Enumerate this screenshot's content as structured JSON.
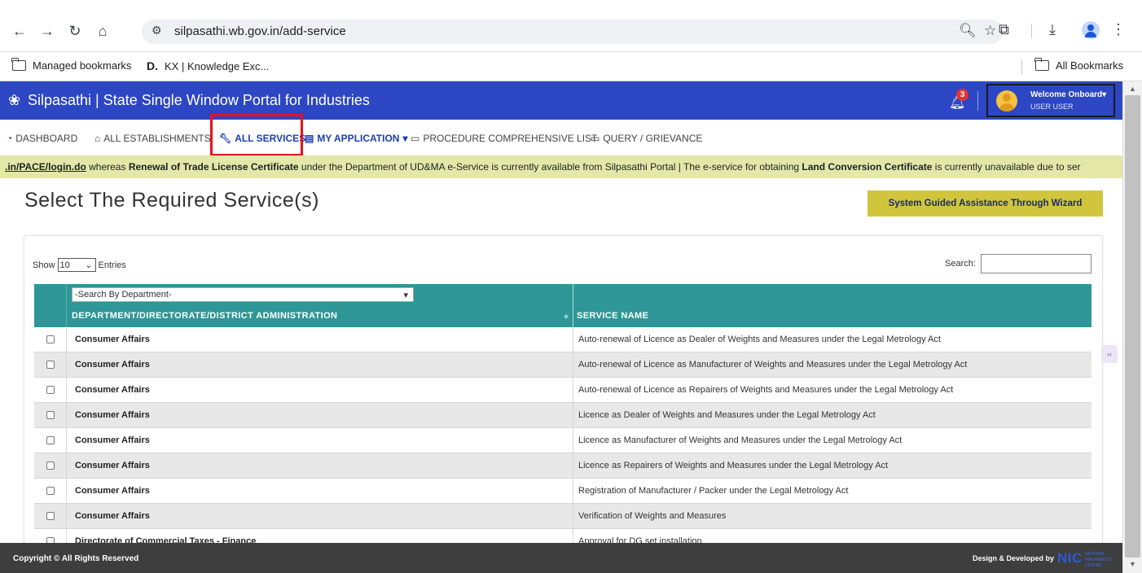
{
  "browser": {
    "url": "silpasathi.wb.gov.in/add-service",
    "bookmarks": [
      {
        "label": "Managed bookmarks"
      },
      {
        "prefix": "D.",
        "label": "KX | Knowledge Exc..."
      }
    ],
    "all_bookmarks_label": "All Bookmarks",
    "icons": {
      "back": "←",
      "forward": "→",
      "reload": "↻",
      "home": "⌂",
      "site_info": "⚙",
      "zoom": "🔍︎",
      "star": "☆",
      "extensions": "⧉",
      "download": "⤓",
      "menu": "⋮"
    }
  },
  "header": {
    "logo_icon": "❀",
    "title": "Silpasathi | State Single Window Portal for Industries",
    "notification_count": "3",
    "bell_icon": "🔔︎",
    "welcome": "Welcome Onboard",
    "user": "USER USER"
  },
  "nav": {
    "items": [
      {
        "icon": "◔",
        "label": "DASHBOARD"
      },
      {
        "icon": "⌂",
        "label": "ALL ESTABLISHMENTS"
      },
      {
        "icon": "🔧︎",
        "label": "ALL SERVICES"
      },
      {
        "icon": "▤",
        "label": "MY APPLICATION",
        "caret": "▾"
      },
      {
        "icon": "▭",
        "label": "PROCEDURE COMPREHENSIVE LIST"
      },
      {
        "icon": "▭",
        "label": "QUERY / GRIEVANCE"
      }
    ]
  },
  "ticker": {
    "link": ".in/PACE/login.do",
    "t1": " whereas ",
    "b1": "Renewal of Trade License Certificate",
    "t2": " under the Department of UD&MA e-Service is currently available from Silpasathi Portal | The e-service for obtaining ",
    "b2": "Land Conversion Certificate",
    "t3": " is currently unavailable due to ser"
  },
  "main": {
    "page_title": "Select The Required Service(s)",
    "wizard_button": "System Guided Assistance Through Wizard",
    "show_label": "Show",
    "entries_value": "10",
    "entries_label": "Entries",
    "search_label": "Search:",
    "search_value": ""
  },
  "table": {
    "dept_filter_placeholder": "-Search By Department-",
    "columns": [
      "DEPARTMENT/DIRECTORATE/DISTRICT ADMINISTRATION",
      "SERVICE NAME"
    ],
    "rows": [
      {
        "dept": "Consumer Affairs",
        "service": "Auto-renewal of Licence as Dealer of Weights and Measures under the Legal Metrology Act"
      },
      {
        "dept": "Consumer Affairs",
        "service": "Auto-renewal of Licence as Manufacturer of Weights and Measures under the Legal Metrology Act"
      },
      {
        "dept": "Consumer Affairs",
        "service": "Auto-renewal of Licence as Repairers of Weights and Measures under the Legal Metrology Act"
      },
      {
        "dept": "Consumer Affairs",
        "service": "Licence as Dealer of Weights and Measures under the Legal Metrology Act"
      },
      {
        "dept": "Consumer Affairs",
        "service": "Licence as Manufacturer of Weights and Measures under the Legal Metrology Act"
      },
      {
        "dept": "Consumer Affairs",
        "service": "Licence as Repairers of Weights and Measures under the Legal Metrology Act"
      },
      {
        "dept": "Consumer Affairs",
        "service": "Registration of Manufacturer / Packer under the Legal Metrology Act"
      },
      {
        "dept": "Consumer Affairs",
        "service": "Verification of Weights and Measures"
      },
      {
        "dept": "Directorate of Commercial Taxes - Finance",
        "service": "Approval for DG set installation"
      }
    ]
  },
  "footer": {
    "copyright": "Copyright © All Rights Reserved",
    "designed_by": "Design & Developed by",
    "nic_logo": "NIC",
    "nic_sub": "NATIONAL INFORMATICS CENTRE"
  },
  "colors": {
    "header_blue": "#2d46c4",
    "table_header_teal": "#2e9696",
    "ticker_bg": "#e3e8a9",
    "wizard_btn": "#d1c53e",
    "highlight_red": "#e8131b",
    "footer_bg": "#3e3e3e"
  }
}
